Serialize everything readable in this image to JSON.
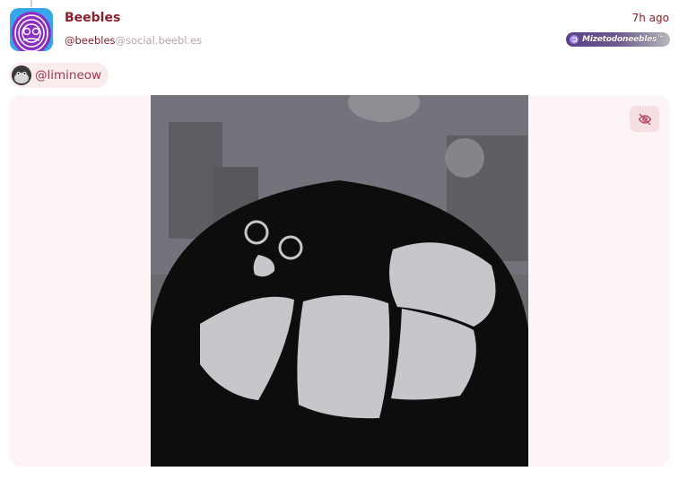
{
  "post": {
    "display_name": "Beebles",
    "handle_user": "@beebles",
    "handle_domain": "@social.beebl.es",
    "timestamp": "7h ago",
    "instance_badge": "Mizetodoneebles™"
  },
  "mention": {
    "label": "@limineow"
  },
  "media": {
    "alt": "",
    "hide_button_icon": "eye-off-icon"
  },
  "colors": {
    "accent": "#8b1f2d",
    "handle_muted": "#b9a2a8",
    "panel_bg": "#fdf5f5",
    "chip_bg": "#f8eced"
  }
}
